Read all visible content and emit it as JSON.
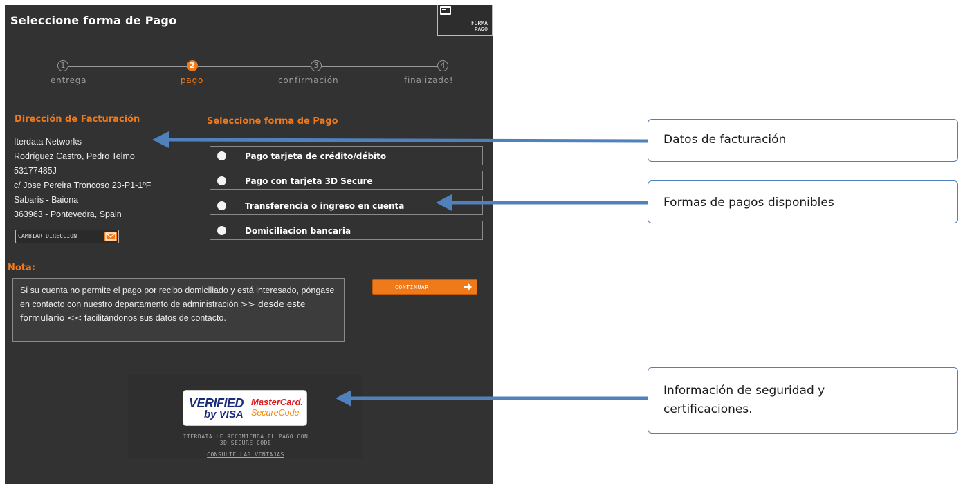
{
  "panel": {
    "title": "Seleccione forma de Pago",
    "corner_badge": "FORMA\nPAGO",
    "corner_icon": "card-icon"
  },
  "steps": [
    {
      "number": "1",
      "label": "entrega",
      "active": false
    },
    {
      "number": "2",
      "label": "pago",
      "active": true
    },
    {
      "number": "3",
      "label": "confirmación",
      "active": false
    },
    {
      "number": "4",
      "label": "finalizado!",
      "active": false
    }
  ],
  "billing": {
    "title": "Dirección de Facturación",
    "lines": [
      "Iterdata Networks",
      "Rodríguez Castro, Pedro Telmo",
      "53177485J",
      "c/ Jose Pereira Troncoso 23-P1-1ºF",
      "Sabarís - Baiona",
      "363963 - Pontevedra, Spain"
    ],
    "change_button": "CAMBIAR DIRECCION"
  },
  "payment": {
    "title": "Seleccione forma de Pago",
    "options": [
      "Pago tarjeta de crédito/débito",
      "Pago con tarjeta 3D Secure",
      "Transferencia o ingreso en cuenta",
      "Domiciliacion bancaria"
    ],
    "continue_button": "CONTINUAR"
  },
  "note": {
    "title": "Nota:",
    "text_before": "Si su cuenta no permite el pago por recibo domiciliado y está interesado, póngase en contacto con nuestro departamento de administración ",
    "link": ">> desde este formulario <<",
    "text_after": " facilitándonos sus datos de contacto."
  },
  "security": {
    "visa_line1": "VERIFIED",
    "visa_line2": "by VISA",
    "mc_line1": "MasterCard.",
    "mc_line2": "SecureCode",
    "recommendation": "ITERDATA LE RECOMIENDA EL PAGO CON\n3D SECURE CODE",
    "link": "CONSULTE LAS VENTAJAS"
  },
  "callouts": [
    {
      "id": "billing",
      "text": "Datos de facturación"
    },
    {
      "id": "payment",
      "text": "Formas de pagos disponibles"
    },
    {
      "id": "security",
      "lines": [
        "Información de seguridad y",
        "certificaciones."
      ]
    }
  ],
  "colors": {
    "panel_bg": "#333232",
    "accent_orange": "#f07a1a",
    "callout_border": "#4f81bd",
    "arrow_blue": "#4f81bd"
  }
}
